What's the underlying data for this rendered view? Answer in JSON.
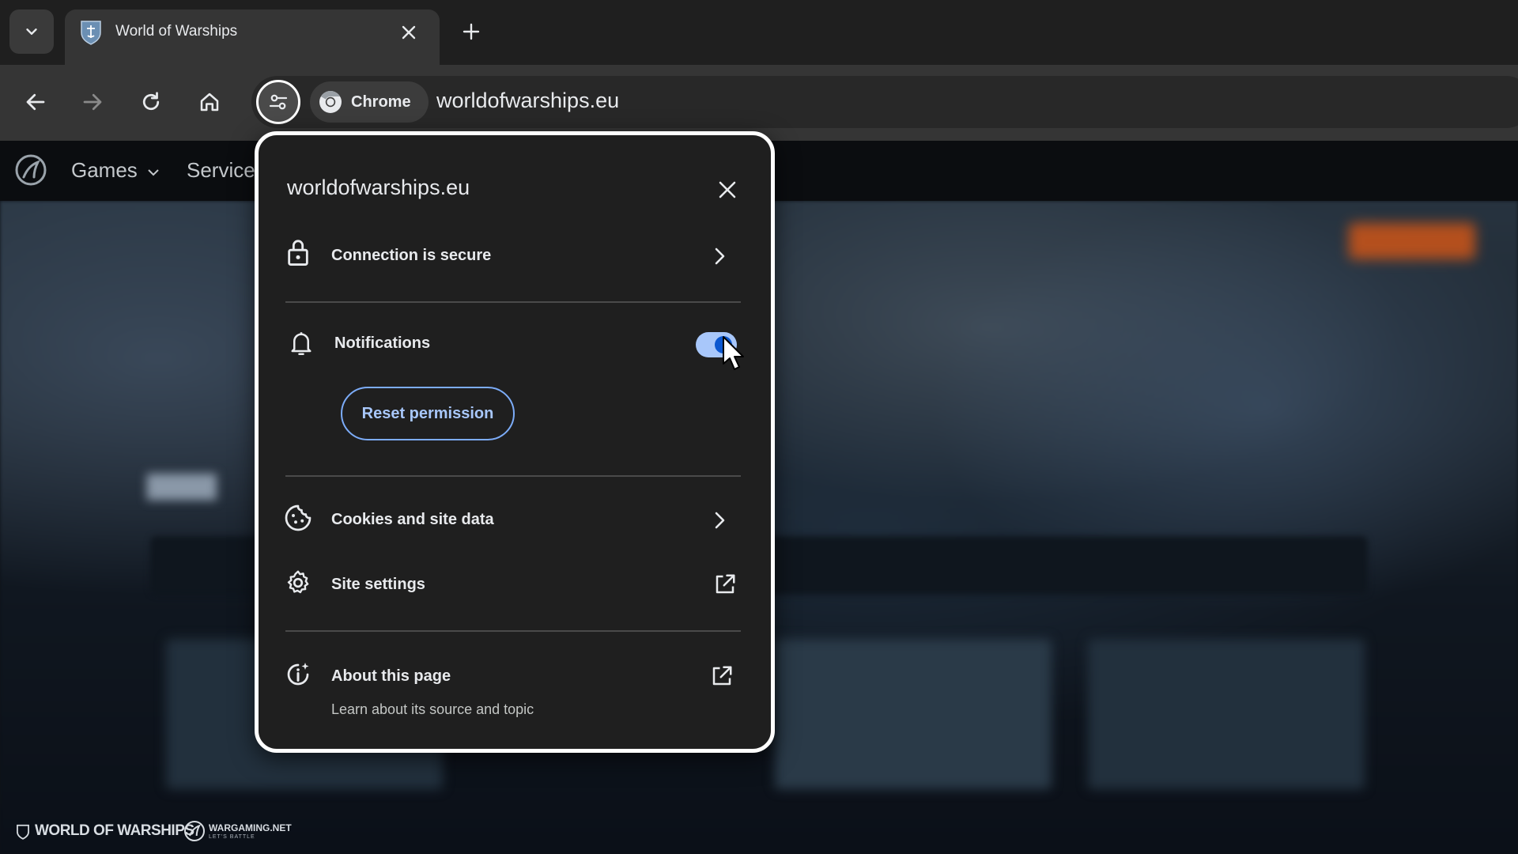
{
  "browser": {
    "tab": {
      "title": "World of Warships"
    },
    "omnibox": {
      "chip_label": "Chrome",
      "url": "worldofwarships.eu"
    }
  },
  "site": {
    "nav": {
      "games": "Games",
      "services": "Service"
    },
    "footer": {
      "wows_brand": "WORLD OF WARSHIPS",
      "wg_brand": "WARGAMING.NET",
      "wg_tagline": "LET'S BATTLE"
    }
  },
  "popup": {
    "title": "worldofwarships.eu",
    "connection": {
      "label": "Connection is secure"
    },
    "notifications": {
      "label": "Notifications",
      "enabled": true,
      "reset_label": "Reset permission"
    },
    "cookies": {
      "label": "Cookies and site data"
    },
    "site_settings": {
      "label": "Site settings"
    },
    "about": {
      "label": "About this page",
      "subtitle": "Learn about its source and topic"
    }
  },
  "colors": {
    "popup_bg": "#1f1f1f",
    "accent": "#a8c7fa",
    "toggle_knob": "#0b57d0"
  },
  "icons": [
    "chevron-down-icon",
    "close-icon",
    "plus-icon",
    "back-icon",
    "forward-icon",
    "reload-icon",
    "home-icon",
    "tune-icon",
    "chrome-icon",
    "lock-icon",
    "bell-icon",
    "cookie-icon",
    "gear-icon",
    "chevron-right-icon",
    "open-external-icon",
    "info-sparkle-icon"
  ]
}
